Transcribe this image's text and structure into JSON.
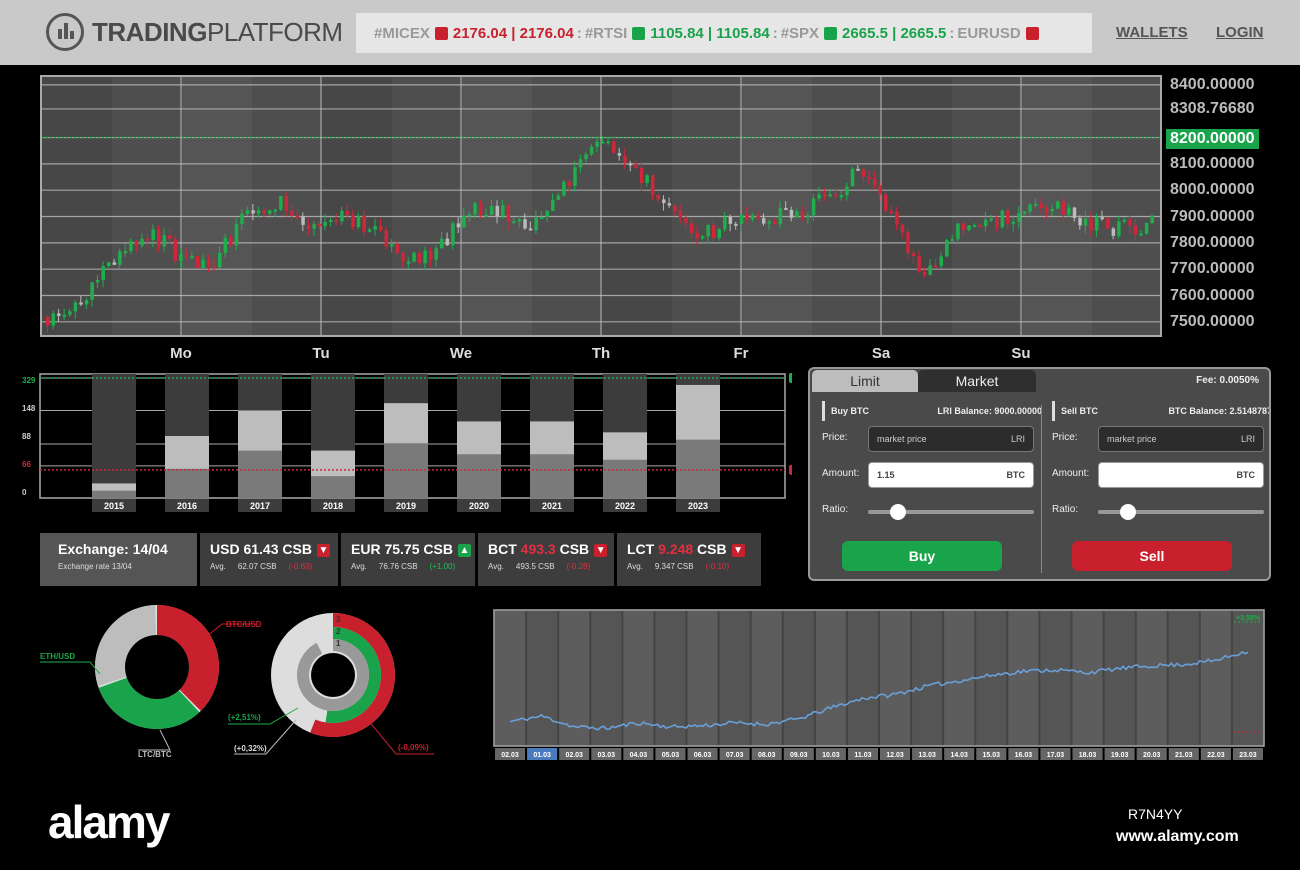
{
  "header": {
    "brand_bold": "TRADING",
    "brand_thin": "PLATFORM",
    "ticker": [
      {
        "symbol": "#MICEX",
        "dir": "dn",
        "value": "2176.04 | 2176.04"
      },
      {
        "symbol": "#RTSI",
        "dir": "up",
        "value": "1105.84 | 1105.84"
      },
      {
        "symbol": "#SPX",
        "dir": "up",
        "value": "2665.5 | 2665.5"
      },
      {
        "symbol": "EURUSD",
        "dir": "dn",
        "value": ""
      }
    ],
    "nav": {
      "wallets": "WALLETS",
      "login": "LOGIN"
    }
  },
  "main_chart": {
    "price_labels": [
      "8400.00000",
      "8308.76680",
      "8200.00000",
      "8100.00000",
      "8000.00000",
      "7900.00000",
      "7800.00000",
      "7700.00000",
      "7600.00000",
      "7500.00000"
    ],
    "highlighted_price": "8200.00000",
    "days": [
      "Mo",
      "Tu",
      "We",
      "Th",
      "Fr",
      "Sa",
      "Su"
    ]
  },
  "chart_data": [
    {
      "type": "candlestick",
      "title": "",
      "ylim": [
        7450,
        8430
      ],
      "y_ticks": [
        8400,
        8308.7668,
        8200,
        8100,
        8000,
        7900,
        7800,
        7700,
        7600,
        7500
      ],
      "x_labels": [
        "Mo",
        "Tu",
        "We",
        "Th",
        "Fr",
        "Sa",
        "Su"
      ],
      "reference_line": 8200,
      "trend_close": [
        7520,
        7580,
        7720,
        7850,
        7760,
        7700,
        7880,
        7960,
        7870,
        7900,
        7860,
        7720,
        7760,
        7940,
        7920,
        7860,
        8020,
        8200,
        8080,
        7960,
        7800,
        7900,
        7880,
        7920,
        7960,
        8080,
        7880,
        7680,
        7840,
        7880,
        7920,
        7940,
        7880,
        7850,
        7880
      ]
    },
    {
      "type": "bar",
      "categories": [
        "2015",
        "2016",
        "2017",
        "2018",
        "2019",
        "2020",
        "2021",
        "2022",
        "2023"
      ],
      "y_ticks": [
        "329",
        "148",
        "88",
        "66",
        "0"
      ],
      "ylim": [
        0,
        340
      ],
      "upper_line": 329,
      "lower_line": 77,
      "series": [
        {
          "values": [
            40,
            170,
            240,
            130,
            260,
            210,
            210,
            180,
            310
          ]
        },
        {
          "values": [
            20,
            80,
            130,
            60,
            150,
            120,
            120,
            105,
            160
          ]
        }
      ]
    },
    {
      "type": "pie",
      "labels": [
        "BTC/USD",
        "ETH/USD",
        "LTC/BTC"
      ],
      "values": [
        38,
        32,
        30
      ],
      "colors": [
        "#c8202c",
        "#19a34a",
        "#bdbdbd"
      ]
    },
    {
      "type": "pie",
      "labels": [
        "(+2,51%)",
        "(+0,32%)",
        "(-0,09%)"
      ],
      "values": [
        30,
        30,
        40
      ],
      "inner_marks": [
        "3",
        "2",
        "1"
      ],
      "colors": [
        "#19a34a",
        "#cccccc",
        "#c8202c"
      ]
    },
    {
      "type": "line",
      "x": [
        "02.03",
        "01.03",
        "02.03",
        "03.03",
        "04.03",
        "05.03",
        "06.03",
        "07.03",
        "08.03",
        "09.03",
        "10.03",
        "11.03",
        "12.03",
        "13.03",
        "14.03",
        "15.03",
        "16.03",
        "17.03",
        "18.03",
        "19.03",
        "20.03",
        "21.03",
        "22.03",
        "23.03"
      ],
      "values": [
        18,
        22,
        14,
        13,
        17,
        14,
        15,
        17,
        16,
        20,
        28,
        35,
        38,
        44,
        48,
        52,
        55,
        56,
        54,
        57,
        59,
        60,
        63,
        70
      ],
      "upper_label": "+3,58%",
      "ylim": [
        0,
        100
      ],
      "color": "#6a9fd8"
    }
  ],
  "trade_panel": {
    "tabs": [
      "Limit",
      "Market"
    ],
    "fee": "Fee: 0.0050%",
    "buy": {
      "title": "Buy BTC",
      "balance": "LRI Balance: 9000.00000",
      "price_label": "Price:",
      "price_value": "market price",
      "price_unit": "LRI",
      "amount_label": "Amount:",
      "amount_value": "1.15",
      "amount_unit": "BTC",
      "ratio_label": "Ratio:",
      "ratio": 0.18,
      "button": "Buy"
    },
    "sell": {
      "title": "Sell BTC",
      "balance": "BTC Balance: 2.5148787",
      "price_label": "Price:",
      "price_value": "market price",
      "price_unit": "LRI",
      "amount_label": "Amount:",
      "amount_value": "",
      "amount_unit": "BTC",
      "ratio_label": "Ratio:",
      "ratio": 0.18,
      "button": "Sell"
    }
  },
  "exchange": {
    "title": "Exchange: 14/04",
    "subtitle": "Exchange rate 13/04",
    "currencies": [
      {
        "code": "USD",
        "value": "61.43",
        "unit": "CSB",
        "dir": "dn",
        "avg_label": "Avg.",
        "avg": "62.07 CSB",
        "change": "(-0.63)",
        "value_red": false
      },
      {
        "code": "EUR",
        "value": "75.75",
        "unit": "CSB",
        "dir": "up",
        "avg_label": "Avg.",
        "avg": "76.76 CSB",
        "change": "(+1.00)",
        "value_red": false
      },
      {
        "code": "BCT",
        "value": "493.3",
        "unit": "CSB",
        "dir": "dn",
        "avg_label": "Avg.",
        "avg": "493.5 CSB",
        "change": "(-0.28)",
        "value_red": true
      },
      {
        "code": "LCT",
        "value": "9.248",
        "unit": "CSB",
        "dir": "dn",
        "avg_label": "Avg.",
        "avg": "9.347 CSB",
        "change": "(-0.10)",
        "value_red": true
      }
    ]
  },
  "watermark": {
    "logo": "alamy",
    "image_id": "R7N4YY",
    "url": "www.alamy.com"
  }
}
